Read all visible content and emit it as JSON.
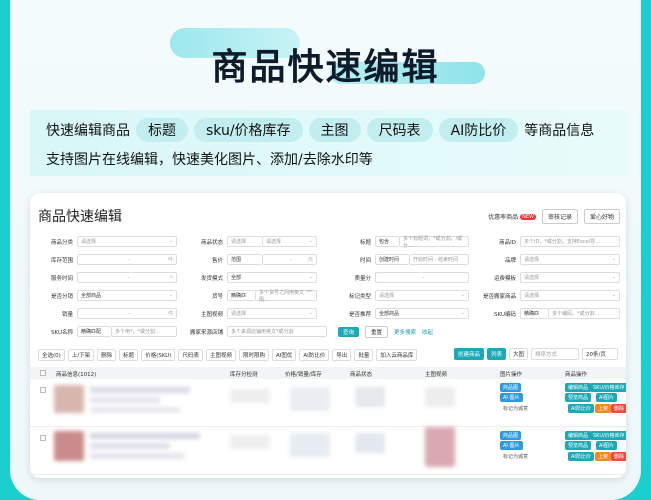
{
  "header": {
    "title": "商品快速编辑"
  },
  "features": {
    "line1_prefix": "快速编辑商品",
    "tags": [
      "标题",
      "sku/价格库存",
      "主图",
      "尺码表",
      "AI防比价"
    ],
    "line1_suffix": "等商品信息",
    "line2": "支持图片在线编辑，快速美化图片、添加/去除水印等"
  },
  "panel": {
    "title": "商品快速编辑",
    "top_link": "优惠率商品",
    "top_badge": "NEW",
    "top_buttons": [
      "审核记录",
      "爱心好物"
    ]
  },
  "filters": {
    "row1": [
      {
        "label": "商品分类",
        "value": "请选择"
      },
      {
        "label": "商品状态",
        "value": "请选择",
        "value2": "请选择"
      },
      {
        "label": "标题",
        "value": "包含",
        "value2": "多个标题词，*或分割，/或分..."
      },
      {
        "label": "商品ID",
        "value": "多个ID，*或分割，支持Excel导..."
      }
    ],
    "row2": [
      {
        "label": "库存范围",
        "value": "-",
        "unit": "件"
      },
      {
        "label": "售价",
        "value": "范围",
        "value2": "-",
        "unit": "元"
      },
      {
        "label": "时间",
        "value": "创建时间",
        "value2": "开始时间 - 结束时间"
      },
      {
        "label": "品牌",
        "value": "请选择"
      }
    ],
    "row3": [
      {
        "label": "服务时间",
        "value": "-"
      },
      {
        "label": "发货模式",
        "value": "全部"
      },
      {
        "label": "质量分",
        "value": "-"
      },
      {
        "label": "运费模板",
        "value": "请选择"
      }
    ],
    "row4": [
      {
        "label": "是否分销",
        "value": "全部商品"
      },
      {
        "label": "货号",
        "value": "精确匹",
        "value2": "多个货号之间用英文 \"*\" 隔..."
      },
      {
        "label": "标记类型",
        "value": "请选择"
      },
      {
        "label": "是否搬家商品",
        "value": "请选择"
      }
    ],
    "row5": [
      {
        "label": "销量",
        "value": "-",
        "unit": "件"
      },
      {
        "label": "主图视频",
        "value": "请选择"
      },
      {
        "label": "是否推荐",
        "value": "全部商品"
      },
      {
        "label": "SKU编码",
        "value": "精确匹",
        "value2": "多个编码，*或分割..."
      }
    ],
    "row6": [
      {
        "label": "SKU名称",
        "value": "精确匹配",
        "value2": "多个用*，*或分割..."
      },
      {
        "label": "搬家来源店铺",
        "value": "多个来源店铺用英文*或分割"
      }
    ],
    "query": "查询",
    "reset": "重置",
    "more": "更多搜索",
    "collapse": "收起"
  },
  "toolbar": {
    "left": [
      "全选(0)",
      "上/下架",
      "删除",
      "标题",
      "价格(SKU)",
      "尺码表",
      "主图视频",
      "限时限购",
      "AI图优",
      "AI防比价",
      "导出",
      "批量",
      "加入云商品库"
    ],
    "create": "创建商品",
    "list": "列表",
    "grid": "大图",
    "sort": "排序方式",
    "per_page": "20条/页"
  },
  "table": {
    "headers": [
      "商品信息(1012)",
      "库存分检测",
      "价格/销量/库存",
      "商品状态",
      "主图视频",
      "图片操作",
      "商品操作"
    ],
    "rows": [
      {
        "ops_img": [
          "商品图",
          "AI 图片",
          "标记为诚意"
        ],
        "ops_goods": [
          "编辑商品",
          "SKU/价格库存",
          "预览商品",
          "AI图片",
          "AI防比价",
          "上架",
          "删除"
        ]
      },
      {
        "ops_img": [
          "商品图",
          "AI 图片",
          "标记为诚意"
        ],
        "ops_goods": [
          "编辑商品",
          "SKU/价格库存",
          "预览商品",
          "AI图片",
          "AI防比价",
          "上架",
          "删除"
        ]
      }
    ]
  }
}
